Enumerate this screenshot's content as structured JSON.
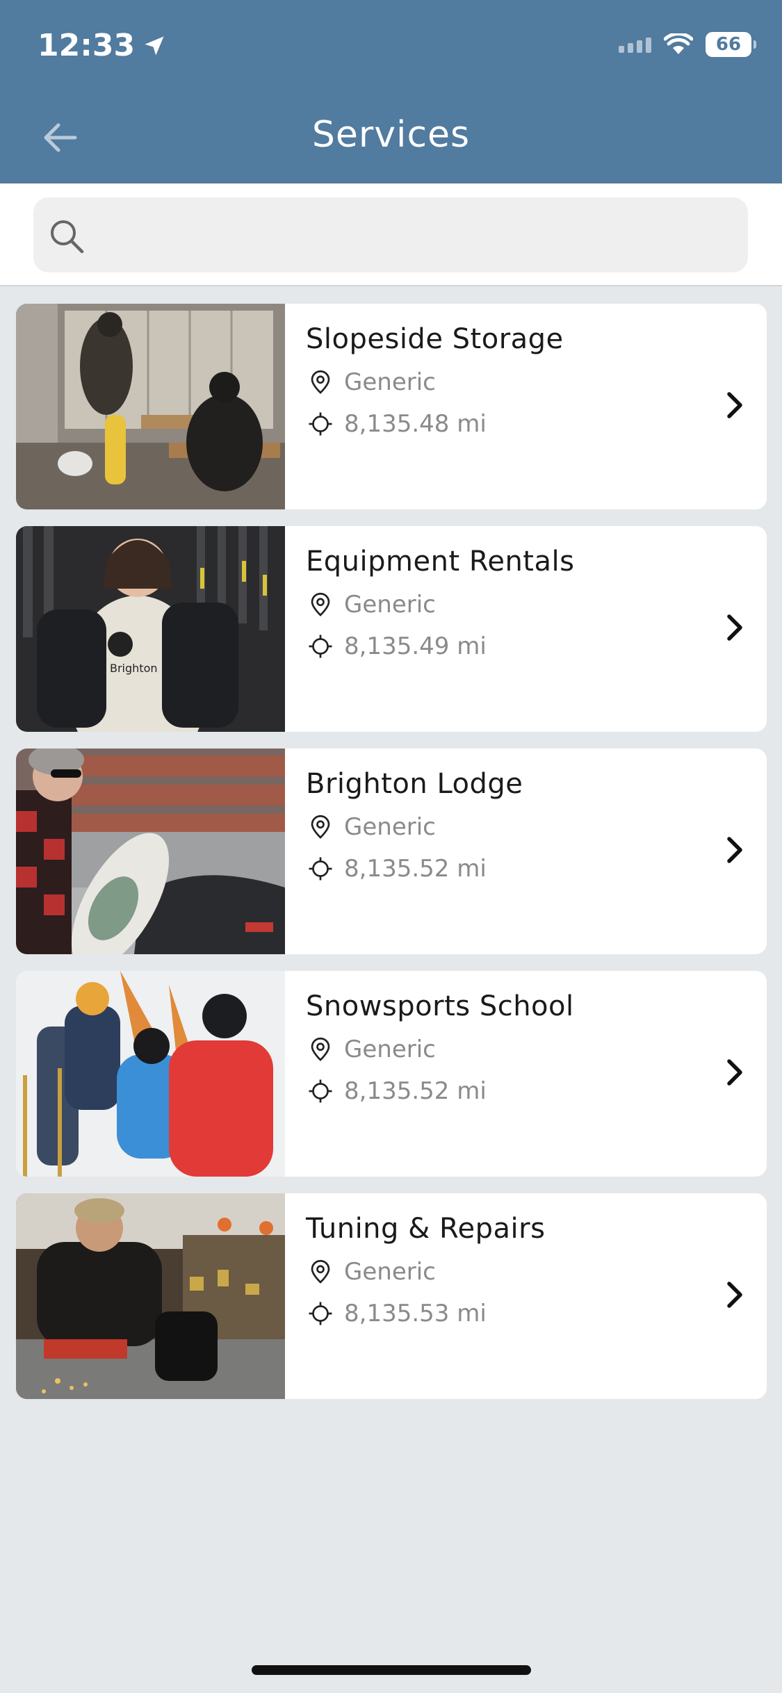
{
  "status_bar": {
    "time": "12:33",
    "battery": "66"
  },
  "header": {
    "title": "Services"
  },
  "search": {
    "placeholder": ""
  },
  "services": [
    {
      "name": "Slopeside Storage",
      "category": "Generic",
      "distance": "8,135.48 mi"
    },
    {
      "name": "Equipment Rentals",
      "category": "Generic",
      "distance": "8,135.49 mi"
    },
    {
      "name": "Brighton Lodge",
      "category": "Generic",
      "distance": "8,135.52 mi"
    },
    {
      "name": "Snowsports School",
      "category": "Generic",
      "distance": "8,135.52 mi"
    },
    {
      "name": "Tuning & Repairs",
      "category": "Generic",
      "distance": "8,135.53 mi"
    }
  ],
  "colors": {
    "header": "#517b9f",
    "background": "#e5e8ea",
    "card": "#ffffff"
  },
  "icons": [
    "location-arrow-icon",
    "signal-icon",
    "wifi-icon",
    "battery-icon",
    "back-arrow-icon",
    "search-icon",
    "location-pin-icon",
    "crosshair-icon",
    "chevron-right-icon"
  ]
}
